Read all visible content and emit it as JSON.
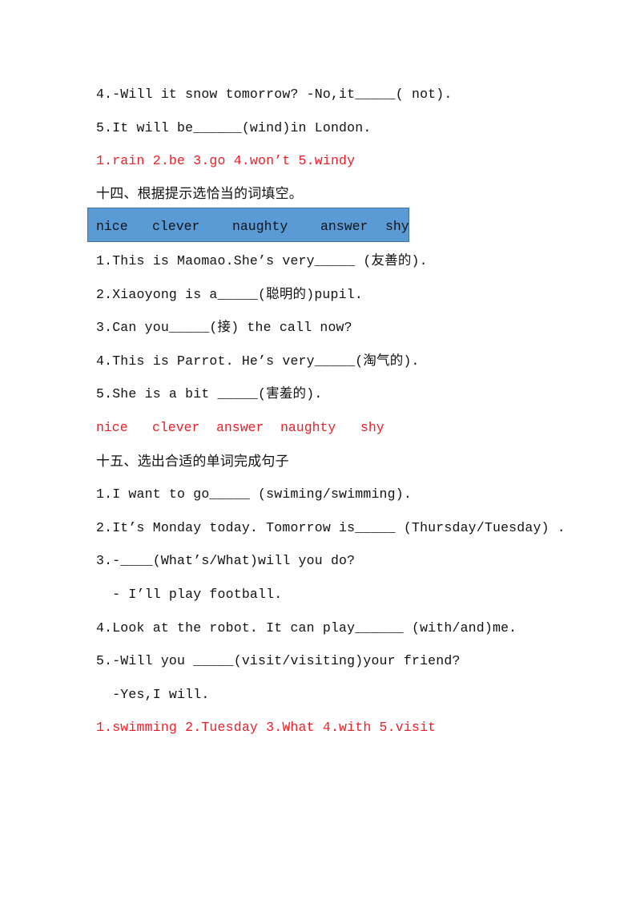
{
  "section13_tail": {
    "q4": "4.-Will it snow tomorrow? -No,it_____( not).",
    "q5": "5.It will be______(wind)in London.",
    "answers": "1.rain 2.be 3.go 4.won’t 5.windy"
  },
  "section14": {
    "heading": "十四、根据提示选恰当的词填空。",
    "word_box": {
      "background_color": "#5b9bd5",
      "words": [
        "nice",
        "clever",
        "naughty",
        "answer",
        "shy"
      ]
    },
    "questions": [
      "1.This is Maomao.She’s very_____ (友善的).",
      "2.Xiaoyong is a_____(聪明的)pupil.",
      "3.Can you_____(接) the call now?",
      "4.This is Parrot. He’s very_____(淘气的).",
      "5.She is a bit _____(害羞的)."
    ],
    "answers": [
      "nice",
      "clever",
      "answer",
      "naughty",
      "shy"
    ]
  },
  "section15": {
    "heading": "十五、选出合适的单词完成句子",
    "lines": [
      "1.I want to go_____ (swiming/swimming).",
      "2.It’s Monday today. Tomorrow is_____ (Thursday/Tuesday) .",
      "3.-____(What’s/What)will you do?",
      "  - I’ll play football.",
      "4.Look at the robot. It can play______ (with/and)me.",
      "5.-Will you _____(visit/visiting)your friend?",
      "  -Yes,I will."
    ],
    "answers": "1.swimming 2.Tuesday 3.What 4.with 5.visit"
  },
  "colors": {
    "answer_text": "#ee1c25",
    "body_text": "#111111"
  }
}
